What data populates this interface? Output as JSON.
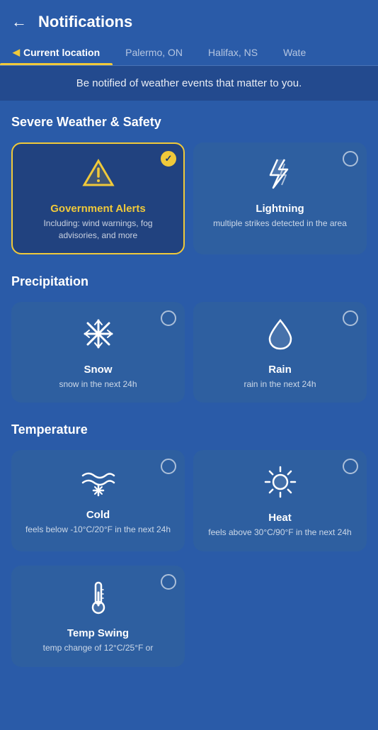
{
  "header": {
    "back_label": "←",
    "title": "Notifications"
  },
  "tabs": [
    {
      "id": "current",
      "label": "Current location",
      "icon": "▶",
      "active": true
    },
    {
      "id": "palermo",
      "label": "Palermo, ON",
      "active": false
    },
    {
      "id": "halifax",
      "label": "Halifax, NS",
      "active": false
    },
    {
      "id": "water",
      "label": "Wate",
      "active": false
    }
  ],
  "banner": {
    "text": "Be notified of weather events that matter to you."
  },
  "sections": [
    {
      "id": "severe",
      "title": "Severe Weather & Safety",
      "cards": [
        {
          "id": "govt-alerts",
          "label": "Government Alerts",
          "desc": "Including: wind warnings, fog advisories, and more",
          "selected": true,
          "label_yellow": true,
          "icon_type": "alert"
        },
        {
          "id": "lightning",
          "label": "Lightning",
          "desc": "multiple strikes detected in the area",
          "selected": false,
          "label_yellow": false,
          "icon_type": "lightning"
        }
      ]
    },
    {
      "id": "precipitation",
      "title": "Precipitation",
      "cards": [
        {
          "id": "snow",
          "label": "Snow",
          "desc": "snow in the next 24h",
          "selected": false,
          "label_yellow": false,
          "icon_type": "snow"
        },
        {
          "id": "rain",
          "label": "Rain",
          "desc": "rain in the next 24h",
          "selected": false,
          "label_yellow": false,
          "icon_type": "rain"
        }
      ]
    },
    {
      "id": "temperature",
      "title": "Temperature",
      "cards": [
        {
          "id": "cold",
          "label": "Cold",
          "desc": "feels below -10°C/20°F in the next 24h",
          "selected": false,
          "label_yellow": false,
          "icon_type": "cold"
        },
        {
          "id": "heat",
          "label": "Heat",
          "desc": "feels above 30°C/90°F in the next 24h",
          "selected": false,
          "label_yellow": false,
          "icon_type": "heat"
        }
      ]
    },
    {
      "id": "temperature2",
      "title": "",
      "cards": [
        {
          "id": "temp-swing",
          "label": "Temp Swing",
          "desc": "temp change of 12°C/25°F or",
          "selected": false,
          "label_yellow": false,
          "icon_type": "thermometer"
        }
      ]
    }
  ]
}
